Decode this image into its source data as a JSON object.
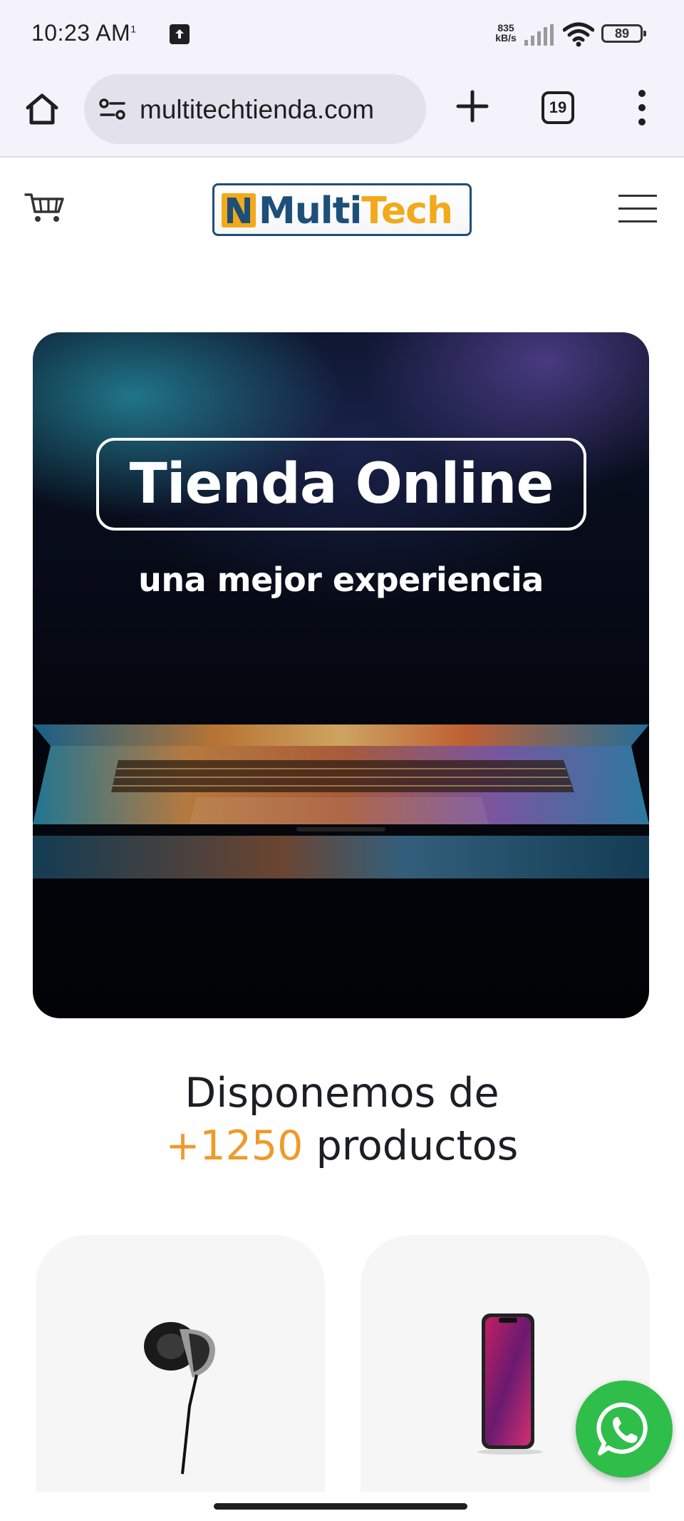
{
  "status_bar": {
    "time": "10:23 AM",
    "time_suffix": "1",
    "net_speed_value": "835",
    "net_speed_unit": "kB/s",
    "battery": "89"
  },
  "browser": {
    "url": "multitechtienda.com",
    "tab_count": "19"
  },
  "header": {
    "logo_text_part1": "Multi",
    "logo_text_part2": "Tech"
  },
  "hero": {
    "title": "Tienda Online",
    "subtitle": "una mejor experiencia"
  },
  "products_section": {
    "heading_line1": "Disponemos de",
    "count": "+1250",
    "heading_suffix": "productos"
  },
  "colors": {
    "accent_orange": "#ee9a2a",
    "brand_blue": "#1d4f78",
    "whatsapp_green": "#2fbe4a"
  },
  "icons": [
    "home-icon",
    "site-info-icon",
    "plus-icon",
    "tabs-icon",
    "more-vert-icon",
    "cart-icon",
    "hamburger-icon",
    "whatsapp-icon"
  ]
}
